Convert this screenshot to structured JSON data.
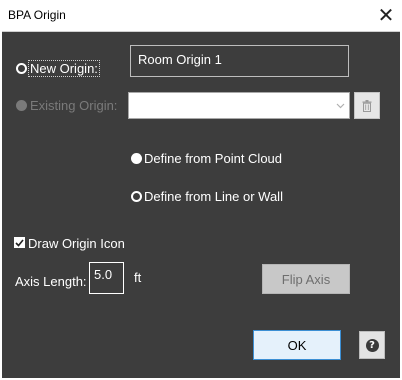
{
  "window": {
    "title": "BPA Origin",
    "close_glyph": "✕"
  },
  "origin": {
    "new_label": "New Origin:",
    "new_value": "Room Origin 1",
    "existing_label": "Existing Origin:",
    "existing_selected": "",
    "delete_icon": "trash-icon"
  },
  "define": {
    "point_cloud_label": "Define from Point Cloud",
    "line_wall_label": "Define from Line or Wall",
    "selected": "point_cloud"
  },
  "options": {
    "draw_icon_label": "Draw Origin Icon",
    "draw_icon_checked": true,
    "axis_length_label": "Axis Length:",
    "axis_length_value": "5.0",
    "axis_unit": "ft",
    "flip_axis_label": "Flip Axis"
  },
  "footer": {
    "ok_label": "OK",
    "help_glyph": "?"
  },
  "colors": {
    "background": "#3d3d3d",
    "ok_border": "#3c8fd4",
    "ok_fill": "#e5f1fb"
  }
}
